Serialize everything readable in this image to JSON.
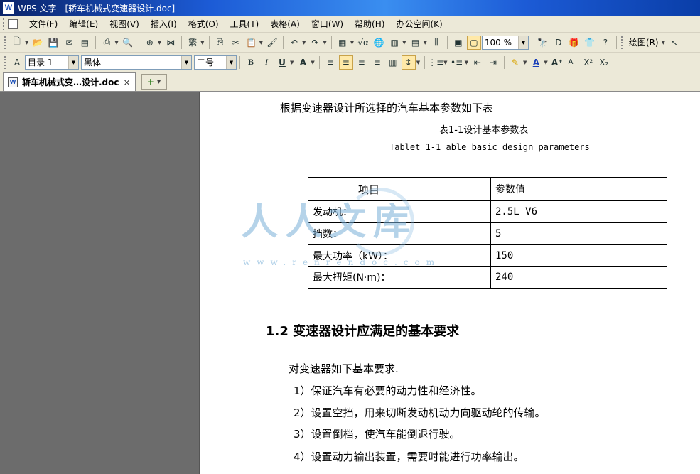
{
  "window": {
    "title": "WPS 文字 - [轿车机械式变速器设计.doc]",
    "logo": "W"
  },
  "menu": [
    "文件(F)",
    "编辑(E)",
    "视图(V)",
    "插入(I)",
    "格式(O)",
    "工具(T)",
    "表格(A)",
    "窗口(W)",
    "帮助(H)",
    "办公空间(K)"
  ],
  "toolbar1": {
    "zoom": "100 %",
    "draw_menu": "绘图(R)"
  },
  "toolbar2": {
    "style": "目录 1",
    "font": "黑体",
    "size": "二号"
  },
  "tab": {
    "label": "轿车机械式变…设计.doc",
    "close": "×",
    "new": "+"
  },
  "doc": {
    "intro": "根据变速器设计所选择的汽车基本参数如下表",
    "caption_cn": "表1-1设计基本参数表",
    "caption_en": "Tablet 1-1 able basic design parameters",
    "table": {
      "headers": [
        "项目",
        "参数值"
      ],
      "rows": [
        [
          "发动机：",
          "2.5L V6"
        ],
        [
          "挡数：",
          "5"
        ],
        [
          "最大功率（kW）：",
          "150"
        ],
        [
          "最大扭矩(N·m)：",
          "240"
        ]
      ]
    },
    "watermark": {
      "text": "人人文库",
      "url": "www.renrendoc.com"
    },
    "heading": "1.2 变速器设计应满足的基本要求",
    "req_intro": "对变速器如下基本要求.",
    "requirements": [
      "1）保证汽车有必要的动力性和经济性。",
      "2）设置空挡，用来切断发动机动力向驱动轮的传输。",
      "3）设置倒档，使汽车能倒退行驶。",
      "4）设置动力输出装置，需要时能进行功率输出。"
    ]
  }
}
